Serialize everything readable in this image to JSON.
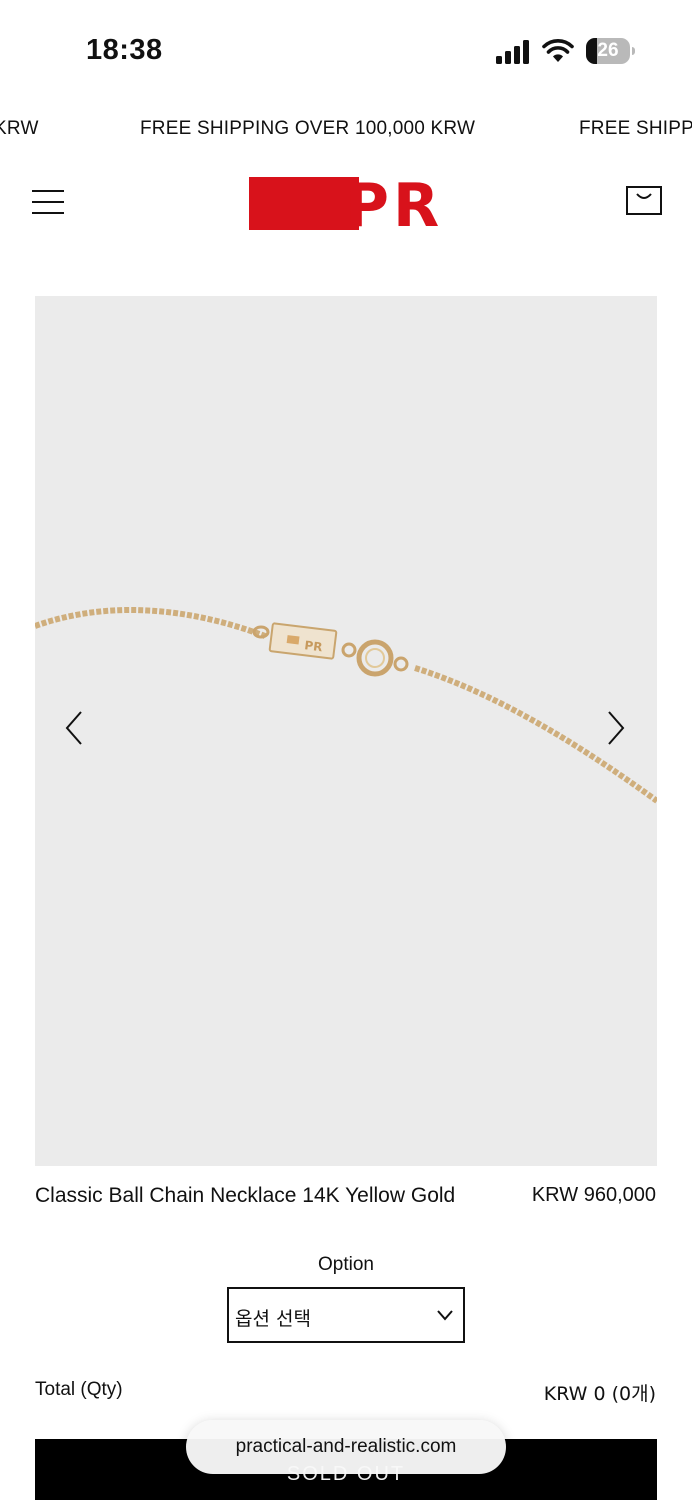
{
  "status_bar": {
    "time": "18:38",
    "battery_level": "26",
    "battery_fraction": 0.26
  },
  "announcement": {
    "fragment_left": "KRW",
    "text": "FREE SHIPPING OVER 100,000 KRW",
    "fragment_right": "FREE SHIPP"
  },
  "header": {
    "logo_text": "PR",
    "brand_color": "#d8121b"
  },
  "gallery": {
    "background": "#ebebeb"
  },
  "product": {
    "name": "Classic Ball Chain Necklace 14K Yellow Gold",
    "price": "KRW 960,000"
  },
  "option": {
    "label": "Option",
    "selected": "옵션 선택"
  },
  "total": {
    "label": "Total (Qty)",
    "value": "KRW 0 (0개)"
  },
  "cta": {
    "label": "SOLD OUT"
  },
  "browser": {
    "url": "practical-and-realistic.com"
  }
}
